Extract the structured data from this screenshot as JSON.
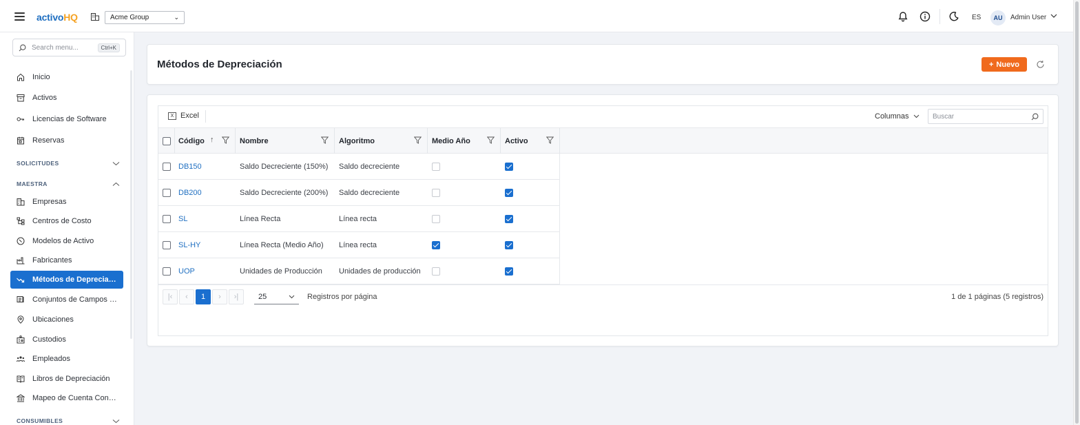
{
  "app": {
    "logo_part1": "activo",
    "logo_part2": "HQ",
    "org_selected": "Acme Group",
    "language": "ES",
    "avatar_initials": "AU",
    "user_name": "Admin User"
  },
  "sidebar": {
    "search_placeholder": "Search menu...",
    "search_shortcut": "Ctrl+K",
    "top_items": [
      {
        "label": "Inicio",
        "icon": "home-icon"
      },
      {
        "label": "Activos",
        "icon": "archive-icon"
      },
      {
        "label": "Licencias de Software",
        "icon": "key-icon"
      },
      {
        "label": "Reservas",
        "icon": "calendar-icon"
      }
    ],
    "sections": {
      "solicitudes": "SOLICITUDES",
      "maestra": "MAESTRA",
      "consumibles": "CONSUMIBLES"
    },
    "maestra_items": [
      {
        "label": "Empresas",
        "icon": "building-icon"
      },
      {
        "label": "Centros de Costo",
        "icon": "hierarchy-icon"
      },
      {
        "label": "Modelos de Activo",
        "icon": "model-icon"
      },
      {
        "label": "Fabricantes",
        "icon": "factory-icon"
      },
      {
        "label": "Métodos de Depreciación",
        "icon": "trend-down-icon",
        "active": true
      },
      {
        "label": "Conjuntos de Campos Personalizados",
        "icon": "fields-icon"
      },
      {
        "label": "Ubicaciones",
        "icon": "location-icon"
      },
      {
        "label": "Custodios",
        "icon": "custodian-icon"
      },
      {
        "label": "Empleados",
        "icon": "people-icon"
      },
      {
        "label": "Libros de Depreciación",
        "icon": "book-icon"
      },
      {
        "label": "Mapeo de Cuenta Contable",
        "icon": "bank-icon"
      }
    ]
  },
  "page": {
    "title": "Métodos de Depreciación",
    "new_button": "Nuevo"
  },
  "grid": {
    "excel_label": "Excel",
    "columns_label": "Columnas",
    "search_placeholder": "Buscar",
    "headers": {
      "code": "Código",
      "name": "Nombre",
      "algorithm": "Algoritmo",
      "half_year": "Medio Año",
      "active": "Activo"
    },
    "rows": [
      {
        "code": "DB150",
        "name": "Saldo Decreciente (150%)",
        "algorithm": "Saldo decreciente",
        "half_year": false,
        "active": true
      },
      {
        "code": "DB200",
        "name": "Saldo Decreciente (200%)",
        "algorithm": "Saldo decreciente",
        "half_year": false,
        "active": true
      },
      {
        "code": "SL",
        "name": "Línea Recta",
        "algorithm": "Línea recta",
        "half_year": false,
        "active": true
      },
      {
        "code": "SL-HY",
        "name": "Línea Recta (Medio Año)",
        "algorithm": "Línea recta",
        "half_year": true,
        "active": true
      },
      {
        "code": "UOP",
        "name": "Unidades de Producción",
        "algorithm": "Unidades de producción",
        "half_year": false,
        "active": true
      }
    ],
    "pager": {
      "current_page": "1",
      "page_size": "25",
      "rows_per_page_label": "Registros por página",
      "info": "1 de 1 páginas (5 registros)"
    }
  }
}
